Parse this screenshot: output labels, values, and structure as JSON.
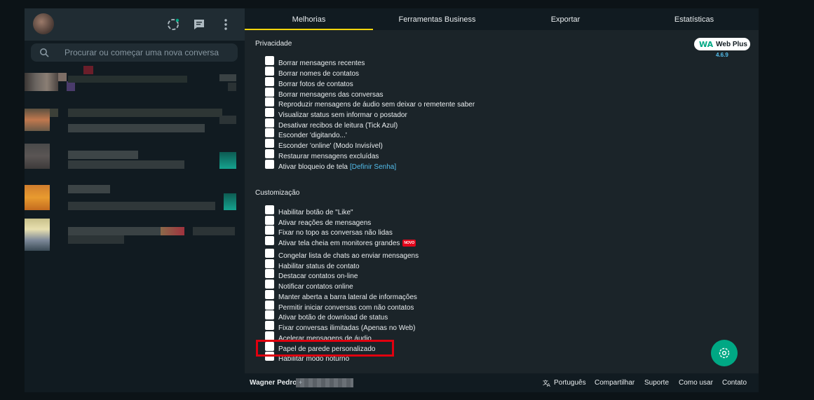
{
  "search": {
    "placeholder": "Procurar ou começar uma nova conversa"
  },
  "tabs": [
    {
      "label": "Melhorias"
    },
    {
      "label": "Ferramentas Business"
    },
    {
      "label": "Exportar"
    },
    {
      "label": "Estatísticas"
    }
  ],
  "brand": {
    "logo": "WA",
    "name": "Web Plus",
    "version": "4.6.9"
  },
  "privacidade": {
    "title": "Privacidade",
    "items": [
      "Borrar mensagens recentes",
      "Borrar nomes de contatos",
      "Borrar fotos de contatos",
      "Borrar mensagens das conversas",
      "Reproduzir mensagens de áudio sem deixar o remetente saber",
      "Visualizar status sem informar o postador",
      "Desativar recibos de leitura (Tick Azul)",
      "Esconder 'digitando...'",
      "Esconder 'online' (Modo Invisível)",
      "Restaurar mensagens excluídas",
      "Ativar bloqueio de tela"
    ],
    "lock_link": "[Definir Senha]"
  },
  "customizacao": {
    "title": "Customização",
    "items": [
      "Habilitar botão de \"Like\"",
      "Ativar reações de mensagens",
      "Fixar no topo as conversas não lidas",
      "Ativar tela cheia em monitores grandes",
      "Congelar lista de chats ao enviar mensagens",
      "Habilitar status de contato",
      "Destacar contatos on-line",
      "Notificar contatos online",
      "Manter aberta a barra lateral de informações",
      "Permitir iniciar conversas com não contatos",
      "Ativar botão de download de status",
      "Fixar conversas ilimitadas (Apenas no Web)",
      "Acelerar mensagens de áudio",
      "Papel de parede personalizado",
      "Habilitar modo noturno"
    ],
    "new_badge": "NOVO"
  },
  "footer": {
    "user": "Wagner Pedro",
    "phone_prefix": "+",
    "language": "Português",
    "share": "Compartilhar",
    "support": "Suporte",
    "how_to": "Como usar",
    "contact": "Contato"
  },
  "colors": {
    "accent_tab": "#f5d50b",
    "brand_green": "#00a884",
    "highlight_red": "#e0000f",
    "badge_red": "#e3061b",
    "link_blue": "#53bdeb"
  },
  "icons": [
    "status-icon",
    "new-chat-icon",
    "menu-icon",
    "search-icon",
    "translate-icon",
    "settings-fab-icon"
  ]
}
